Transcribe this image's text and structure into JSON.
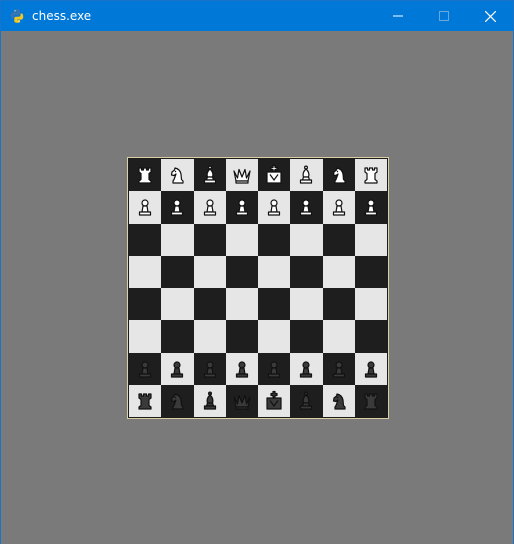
{
  "window": {
    "title": "chess.exe",
    "app_icon": "python-icon"
  },
  "colors": {
    "titlebar": "#0078d7",
    "background": "#7a7a7a",
    "light_square": "#e6e6e6",
    "dark_square": "#1e1e1e",
    "white_piece": "#ffffff",
    "black_piece": "#3a3a3a",
    "board_border": "#d8d0a0"
  },
  "board": {
    "rows": [
      [
        "wR",
        "wN",
        "wB",
        "wQ",
        "wK",
        "wB",
        "wN",
        "wR"
      ],
      [
        "wP",
        "wP",
        "wP",
        "wP",
        "wP",
        "wP",
        "wP",
        "wP"
      ],
      [
        "",
        "",
        "",
        "",
        "",
        "",
        "",
        ""
      ],
      [
        "",
        "",
        "",
        "",
        "",
        "",
        "",
        ""
      ],
      [
        "",
        "",
        "",
        "",
        "",
        "",
        "",
        ""
      ],
      [
        "",
        "",
        "",
        "",
        "",
        "",
        "",
        ""
      ],
      [
        "bP",
        "bP",
        "bP",
        "bP",
        "bP",
        "bP",
        "bP",
        "bP"
      ],
      [
        "bR",
        "bN",
        "bB",
        "bQ",
        "bK",
        "bB",
        "bN",
        "bR"
      ]
    ],
    "top_left_square": "dark"
  }
}
